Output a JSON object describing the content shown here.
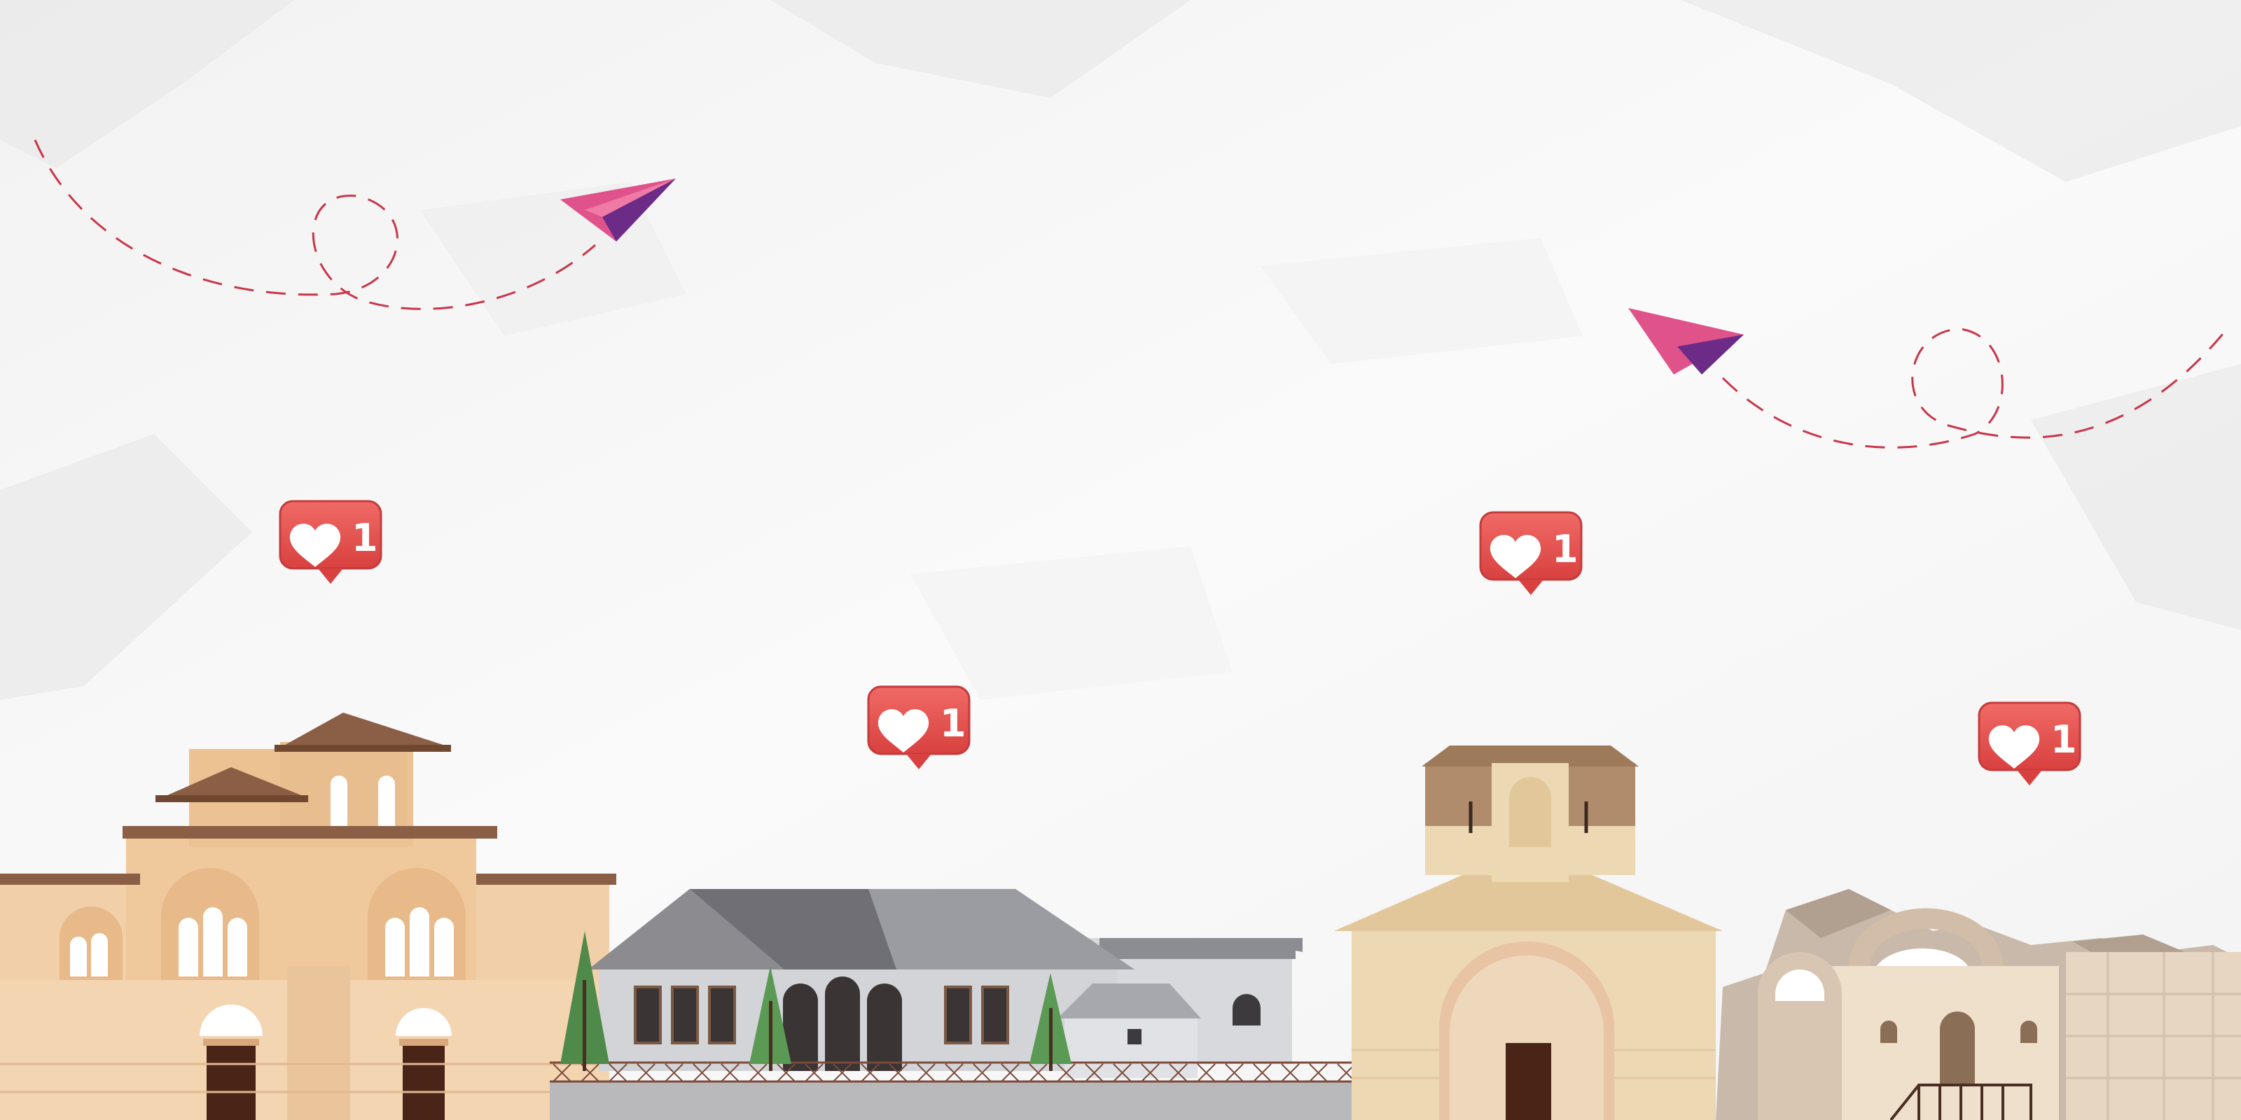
{
  "scene": {
    "colors": {
      "paper": "#f6f6f6",
      "paper_shadow": "#e4e4e4",
      "dash_line": "#c9364a",
      "plane_pink": "#e0528a",
      "plane_purple": "#6b2b86",
      "badge_red": "#e5504f",
      "badge_dark": "#c43b3c"
    }
  },
  "likes": [
    {
      "icon": "heart-icon",
      "count": "1"
    },
    {
      "icon": "heart-icon",
      "count": "1"
    },
    {
      "icon": "heart-icon",
      "count": "1"
    },
    {
      "icon": "heart-icon",
      "count": "1"
    }
  ]
}
